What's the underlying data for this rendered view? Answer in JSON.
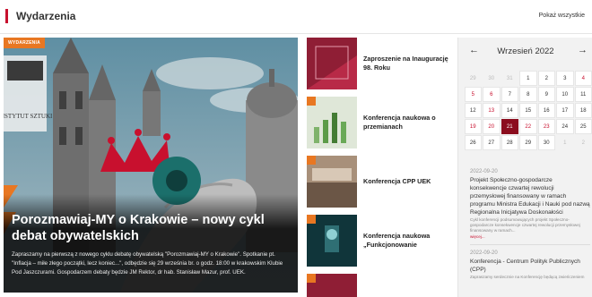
{
  "header": {
    "title": "Wydarzenia",
    "show_all": "Pokaż wszystkie"
  },
  "featured": {
    "badge": "WYDARZENIA",
    "logo_text": "INSTYTUT SZTUKI",
    "title": "Porozmawiaj-MY o Krakowie – nowy cykl debat obywatelskich",
    "description": "Zapraszamy na pierwszą z nowego cyklu debatę obywatelską \"Porozmawiaj-MY o Krakowie\". Spotkanie pt. \"Inflacja – miłe złego początki, lecz koniec...\", odbędzie się 29 września br. o godz. 18:00 w krakowskim Klubie Pod Jaszczurami. Gospodarzem debaty będzie JM Rektor, dr hab. Stanisław Mazur, prof. UEK."
  },
  "list": [
    {
      "title": "Zaproszenie na Inaugurację 98. Roku"
    },
    {
      "title": "Konferencja naukowa o przemianach"
    },
    {
      "title": "Konferencja CPP UEK"
    },
    {
      "title": "Konferencja naukowa „Funkcjonowanie"
    }
  ],
  "calendar": {
    "prev_icon": "←",
    "next_icon": "→",
    "month": "Wrzesień 2022",
    "weeks": [
      [
        {
          "d": "29",
          "m": true
        },
        {
          "d": "30",
          "m": true
        },
        {
          "d": "31",
          "m": true
        },
        {
          "d": "1"
        },
        {
          "d": "2"
        },
        {
          "d": "3"
        },
        {
          "d": "4",
          "e": true
        }
      ],
      [
        {
          "d": "5",
          "e": true
        },
        {
          "d": "6",
          "e": true
        },
        {
          "d": "7"
        },
        {
          "d": "8"
        },
        {
          "d": "9"
        },
        {
          "d": "10"
        },
        {
          "d": "11"
        }
      ],
      [
        {
          "d": "12"
        },
        {
          "d": "13",
          "e": true
        },
        {
          "d": "14"
        },
        {
          "d": "15"
        },
        {
          "d": "16"
        },
        {
          "d": "17"
        },
        {
          "d": "18"
        }
      ],
      [
        {
          "d": "19",
          "e": true
        },
        {
          "d": "20",
          "e": true
        },
        {
          "d": "21",
          "t": true
        },
        {
          "d": "22",
          "e": true
        },
        {
          "d": "23",
          "e": true
        },
        {
          "d": "24"
        },
        {
          "d": "25"
        }
      ],
      [
        {
          "d": "26"
        },
        {
          "d": "27"
        },
        {
          "d": "28"
        },
        {
          "d": "29"
        },
        {
          "d": "30"
        },
        {
          "d": "1",
          "m": true
        },
        {
          "d": "2",
          "m": true
        }
      ]
    ],
    "events": [
      {
        "date": "2022-09-20",
        "title": "Projekt Społeczno-gospodarcze konsekwencje czwartej rewolucji przemysłowej finansowany w ramach programu Ministra Edukacji i Nauki pod nazwą Regionalna Inicjatywa Doskonałości",
        "desc": "Cykl konferencji podsumowujących projekt Społeczno-gospodarcze konsekwencje czwartej rewolucji przemysłowej finansowany w ramach...",
        "more": "więcej..."
      },
      {
        "date": "2022-09-20",
        "title": "Konferencja - Centrum Polityk Publicznych (CPP)",
        "desc": "Zapraszamy serdecznie na Konferencję będącą zwieńczeniem"
      }
    ]
  },
  "colors": {
    "accent_red": "#c8102e",
    "accent_orange": "#e87722",
    "today": "#8b0d1e"
  }
}
